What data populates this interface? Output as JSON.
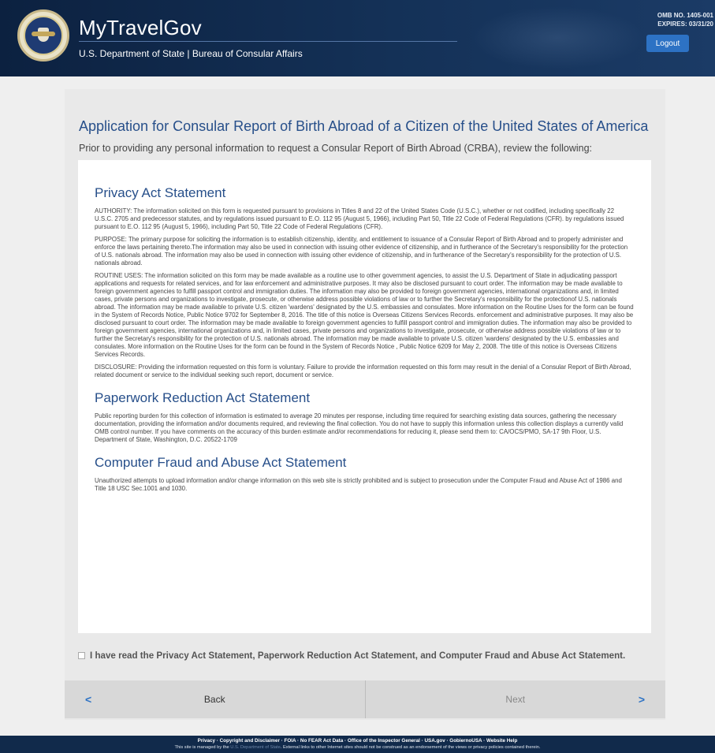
{
  "header": {
    "brand_title": "MyTravelGov",
    "brand_subtitle": "U.S. Department of State | Bureau of Consular Affairs",
    "omb_line1": "OMB NO. 1405-001",
    "omb_line2": "EXPIRES: 03/31/20",
    "logout_label": "Logout"
  },
  "page": {
    "title": "Application for Consular Report of Birth Abroad of a Citizen of the United States of America",
    "intro": "Prior to providing any personal information to request a Consular Report of Birth Abroad (CRBA), review the following:"
  },
  "privacy": {
    "title": "Privacy Act Statement",
    "authority": "AUTHORITY: The information solicited on this form is requested pursuant to provisions in Titles 8 and 22 of the United States Code (U.S.C.), whether or not codified, including specifically 22 U.S.C. 2705 and predecessor statutes, and by regulations issued pursuant to E.O. 112 95 (August 5, 1966), including Part 50, Title 22 Code of Federal Regulations (CFR). by regulations issued pursuant to E.O. 112 95 (August 5, 1966), including Part 50, Title 22 Code of Federal Regulations (CFR).",
    "purpose": "PURPOSE: The primary purpose for soliciting the information is to establish citizenship, identity, and entitlement to issuance of a Consular Report of Birth Abroad and to properly administer and enforce the laws pertaining thereto.The information may also be used in connection with issuing other evidence of citizenship, and in furtherance of the Secretary's responsibility for the protection of U.S. nationals abroad. The information may also be used in connection with issuing other evidence of citizenship, and in furtherance of the Secretary's responsibility for the protection of U.S. nationals abroad.",
    "routine_uses": "ROUTINE USES: The information solicited on this form may be made available as a routine use to other government agencies, to assist the U.S. Department of State in adjudicating passport applications and requests for related services, and for law enforcement and administrative purposes. It may also be disclosed pursuant to court order. The information may be made available to foreign government agencies to fulfill passport control and immigration duties. The information may also be provided to foreign government agencies, international organizations and, in limited cases, private persons and organizations to investigate, prosecute, or otherwise address possible violations of law or to further the Secretary's responsibility for the protectionof U.S. nationals abroad. The information may be made available to private U.S. citizen 'wardens' designated by the U.S. embassies and consulates. More information on the Routine Uses for the form can be found in the System of Records Notice, Public Notice 9702 for September 8, 2016. The title of this notice is Overseas Citizens Services Records. enforcement and administrative purposes. It may also be disclosed pursuant to court order. The information may be made available to foreign government agencies to fulfill passport control and immigration duties. The information may also be provided to foreign government agencies, international organizations and, in limited cases, private persons and organizations to investigate, prosecute, or otherwise address possible violations of law or to further the Secretary's responsibility for the protection of U.S. nationals abroad. The information may be made available to private U.S. citizen 'wardens' designated by the U.S. embassies and consulates. More information on the Routine Uses for the form can be found in the System of Records Notice , Public Notice 6209 for May 2, 2008. The title of this notice is Overseas Citizens Services Records.",
    "disclosure": "DISCLOSURE: Providing the information requested on this form is voluntary. Failure to provide the information requested on this form may result in the denial of a Consular Report of Birth Abroad, related document or service to the individual seeking such report, document or service."
  },
  "paperwork": {
    "title": "Paperwork Reduction Act Statement",
    "body": "Public reporting burden for this collection of information is estimated to average 20 minutes per response, including time required for searching existing data sources, gathering the necessary documentation, providing the information and/or documents required, and reviewing the final collection. You do not have to supply this information unless this collection displays a currently valid OMB control number. If you have comments on the accuracy of this burden estimate and/or recommendations for reducing it, please send them to: CA/OCS/PMO, SA-17 9th Floor, U.S. Department of State, Washington, D.C. 20522-1709"
  },
  "fraud": {
    "title": "Computer Fraud and Abuse Act Statement",
    "body": "Unauthorized attempts to upload information and/or change information on this web site is strictly prohibited and is subject to prosecution under the Computer Fraud and Abuse Act of 1986 and Title 18 USC Sec.1001 and 1030."
  },
  "acknowledgement": {
    "label": "I have read the Privacy Act Statement, Paperwork Reduction Act Statement, and Computer Fraud and Abuse Act Statement.",
    "checked": false
  },
  "nav": {
    "back_label": "Back",
    "next_label": "Next",
    "back_chevron": "<",
    "next_chevron": ">"
  },
  "footer": {
    "links": "Privacy  ·  Copyright and Disclaimer  ·  FOIA  ·  No FEAR Act Data  ·  Office of the Inspector General  ·  USA.gov  ·  GobiernoUSA  ·  Website Help",
    "note_prefix": "This site is managed by the",
    "note_dim": "U.S. Department of State",
    "note_suffix": ". External links to other Internet sites should not be construed as an endorsement of the views or privacy policies contained therein."
  },
  "colors": {
    "header_bg": "#0f2747",
    "title_blue": "#274f8a",
    "logout_button": "#2d72c4",
    "footer_bg": "#112a4b"
  }
}
